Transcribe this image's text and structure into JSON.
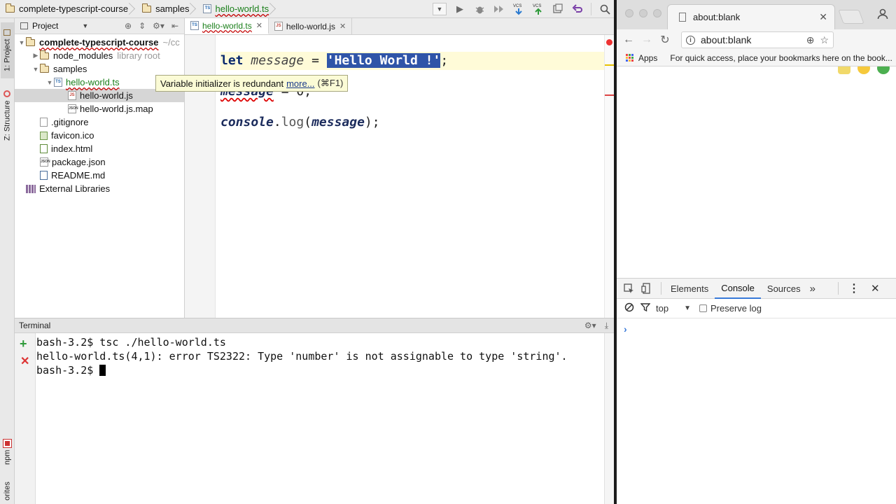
{
  "ide": {
    "breadcrumbs": [
      "complete-typescript-course",
      "samples",
      "hello-world.ts"
    ],
    "left_stripe": {
      "project": "1: Project",
      "structure": "Z: Structure",
      "npm": "npm",
      "favorites": "orites"
    },
    "project_panel": {
      "title": "Project",
      "tree": [
        {
          "label": "complete-typescript-course",
          "extra": "~/cc",
          "icon": "folder-icon",
          "level": 0,
          "expanded": true
        },
        {
          "label": "node_modules",
          "extra": "library root",
          "icon": "folder-icon",
          "level": 1,
          "expanded": false
        },
        {
          "label": "samples",
          "icon": "folder-icon",
          "level": 1,
          "expanded": true
        },
        {
          "label": "hello-world.ts",
          "icon": "typescript-file-icon",
          "level": 2,
          "expanded": true
        },
        {
          "label": "hello-world.js",
          "icon": "javascript-file-icon",
          "level": 3,
          "selected": true
        },
        {
          "label": "hello-world.js.map",
          "icon": "json-file-icon",
          "level": 3
        },
        {
          "label": ".gitignore",
          "icon": "file-icon",
          "level": 1
        },
        {
          "label": "favicon.ico",
          "icon": "image-file-icon",
          "level": 1
        },
        {
          "label": "index.html",
          "icon": "html-file-icon",
          "level": 1
        },
        {
          "label": "package.json",
          "icon": "json-file-icon",
          "level": 1
        },
        {
          "label": "README.md",
          "icon": "markdown-file-icon",
          "level": 1
        },
        {
          "label": "External Libraries",
          "icon": "library-icon",
          "level": 0
        }
      ]
    },
    "editor_tabs": [
      {
        "label": "hello-world.ts",
        "active": true
      },
      {
        "label": "hello-world.js",
        "active": false
      }
    ],
    "code": {
      "line1": {
        "kw": "let",
        "var": "message",
        "eq": "=",
        "str": "'Hello World !'",
        "end": ";"
      },
      "line2": {
        "var": "message",
        "rest": " = 0;"
      },
      "line4": {
        "obj": "console",
        "dot": ".",
        "fn": "log",
        "open": "(",
        "arg": "message",
        "close": ");"
      }
    },
    "tooltip": {
      "text": "Variable initializer is redundant",
      "link": "more...",
      "shortcut": "(⌘F1)"
    },
    "terminal": {
      "title": "Terminal",
      "lines": [
        "bash-3.2$ tsc ./hello-world.ts",
        "hello-world.ts(4,1): error TS2322: Type 'number' is not assignable to type 'string'.",
        "bash-3.2$ "
      ]
    }
  },
  "chrome": {
    "tab_title": "about:blank",
    "address": "about:blank",
    "apps_label": "Apps",
    "bookmarks_hint": "For quick access, place your bookmarks here on the book...",
    "devtools_tabs": [
      "Elements",
      "Console",
      "Sources"
    ],
    "active_devtools_tab": "Console",
    "context": "top",
    "preserve_log": "Preserve log",
    "colors": {
      "devtools_accent": "#3879d9"
    }
  }
}
